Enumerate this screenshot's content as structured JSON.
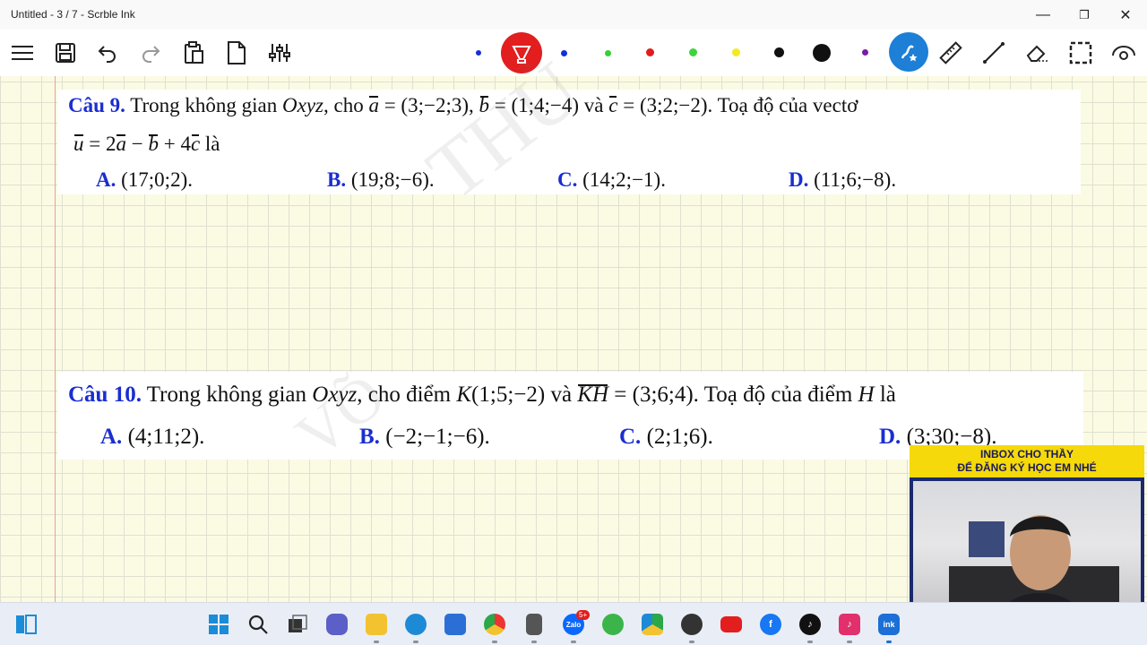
{
  "window": {
    "title": "Untitled - 3 / 7 - Scrble Ink",
    "minimize": "—",
    "restore": "❐",
    "close": "✕"
  },
  "toolbar": {
    "icons": [
      "menu-icon",
      "save-icon",
      "undo-icon",
      "redo-icon",
      "paste-icon",
      "new-page-icon",
      "settings-sliders-icon",
      "highlighter-icon",
      "shapes-pen-icon",
      "ruler-icon",
      "line-icon",
      "eraser-icon",
      "selection-icon",
      "view-icon"
    ],
    "colors": [
      "#1530d8",
      "#1530d8",
      "#35d135",
      "#e01d1d",
      "#3ed43e",
      "#f2ea23",
      "#111111",
      "#111111",
      "#7a1aa8"
    ]
  },
  "q9": {
    "number": "Câu 9.",
    "line1_pre": " Trong không gian ",
    "oxyz": "Oxyz",
    "line1_mid": ", cho ",
    "a": "a",
    "a_val": " = (3;−2;3), ",
    "b": "b",
    "b_val": " = (1;4;−4)  và  ",
    "c": "c",
    "c_val": " = (3;2;−2). Toạ độ của vectơ",
    "u": "u",
    "line2_a": " = 2",
    "line2_b": " − ",
    "line2_c": " + 4",
    "line2_end": "  là",
    "options": [
      {
        "label": "A.",
        "value": "(17;0;2)."
      },
      {
        "label": "B.",
        "value": "(19;8;−6)."
      },
      {
        "label": "C.",
        "value": "(14;2;−1)."
      },
      {
        "label": "D.",
        "value": "(11;6;−8)."
      }
    ]
  },
  "q10": {
    "number": "Câu 10.",
    "line1_pre": " Trong không gian ",
    "oxyz": "Oxyz",
    "line1_mid": ", cho điểm ",
    "k": "K",
    "k_val": "(1;5;−2)  và  ",
    "kh": "KH",
    "kh_val": " = (3;6;4). Toạ độ của điểm ",
    "h": "H",
    "line1_end": "  là",
    "options": [
      {
        "label": "A.",
        "value": "(4;11;2)."
      },
      {
        "label": "B.",
        "value": "(−2;−1;−6)."
      },
      {
        "label": "C.",
        "value": "(2;1;6)."
      },
      {
        "label": "D.",
        "value": "(3;30;−8)."
      }
    ]
  },
  "overlay": {
    "line1": "INBOX CHO THẦY",
    "line2": "ĐỂ ĐĂNG KÝ HỌC EM NHÉ"
  },
  "taskbar": {
    "apps": [
      "widgets-icon",
      "start-icon",
      "search-icon",
      "task-view-icon",
      "teams-icon",
      "file-explorer-icon",
      "edge-icon",
      "store-icon",
      "chrome-icon",
      "calculator-icon",
      "zalo-icon",
      "app-green-icon",
      "google-drive-icon",
      "obs-icon",
      "youtube-icon",
      "facebook-icon",
      "tiktok-icon",
      "tiktok-studio-icon",
      "scrble-ink-icon"
    ],
    "zalo_badge": "5+"
  }
}
